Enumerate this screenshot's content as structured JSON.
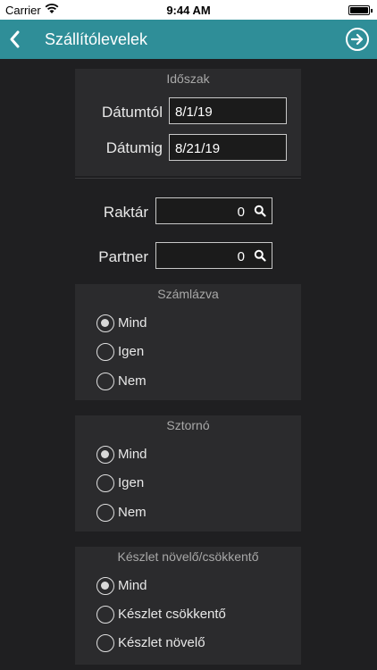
{
  "status": {
    "carrier": "Carrier",
    "time": "9:44 AM"
  },
  "nav": {
    "title": "Szállítólevelek"
  },
  "period": {
    "title": "Időszak",
    "from_label": "Dátumtól",
    "from_value": "8/1/19",
    "to_label": "Dátumig",
    "to_value": "8/21/19"
  },
  "lookup": {
    "warehouse_label": "Raktár",
    "warehouse_value": "0",
    "partner_label": "Partner",
    "partner_value": "0"
  },
  "invoiced": {
    "title": "Számlázva",
    "options": [
      "Mind",
      "Igen",
      "Nem"
    ],
    "selected": "Mind"
  },
  "storno": {
    "title": "Sztornó",
    "options": [
      "Mind",
      "Igen",
      "Nem"
    ],
    "selected": "Mind"
  },
  "stock": {
    "title": "Készlet növelő/csökkentő",
    "options": [
      "Mind",
      "Készlet csökkentő",
      "Készlet növelő"
    ],
    "selected": "Mind"
  },
  "icons": {
    "back": "chevron-left-icon",
    "next": "arrow-right-circle-icon",
    "search": "search-icon",
    "wifi": "wifi-icon",
    "battery": "battery-icon"
  },
  "colors": {
    "nav_bar": "#2f8e98",
    "background": "#1f1f21",
    "panel": "#2b2b2d"
  }
}
